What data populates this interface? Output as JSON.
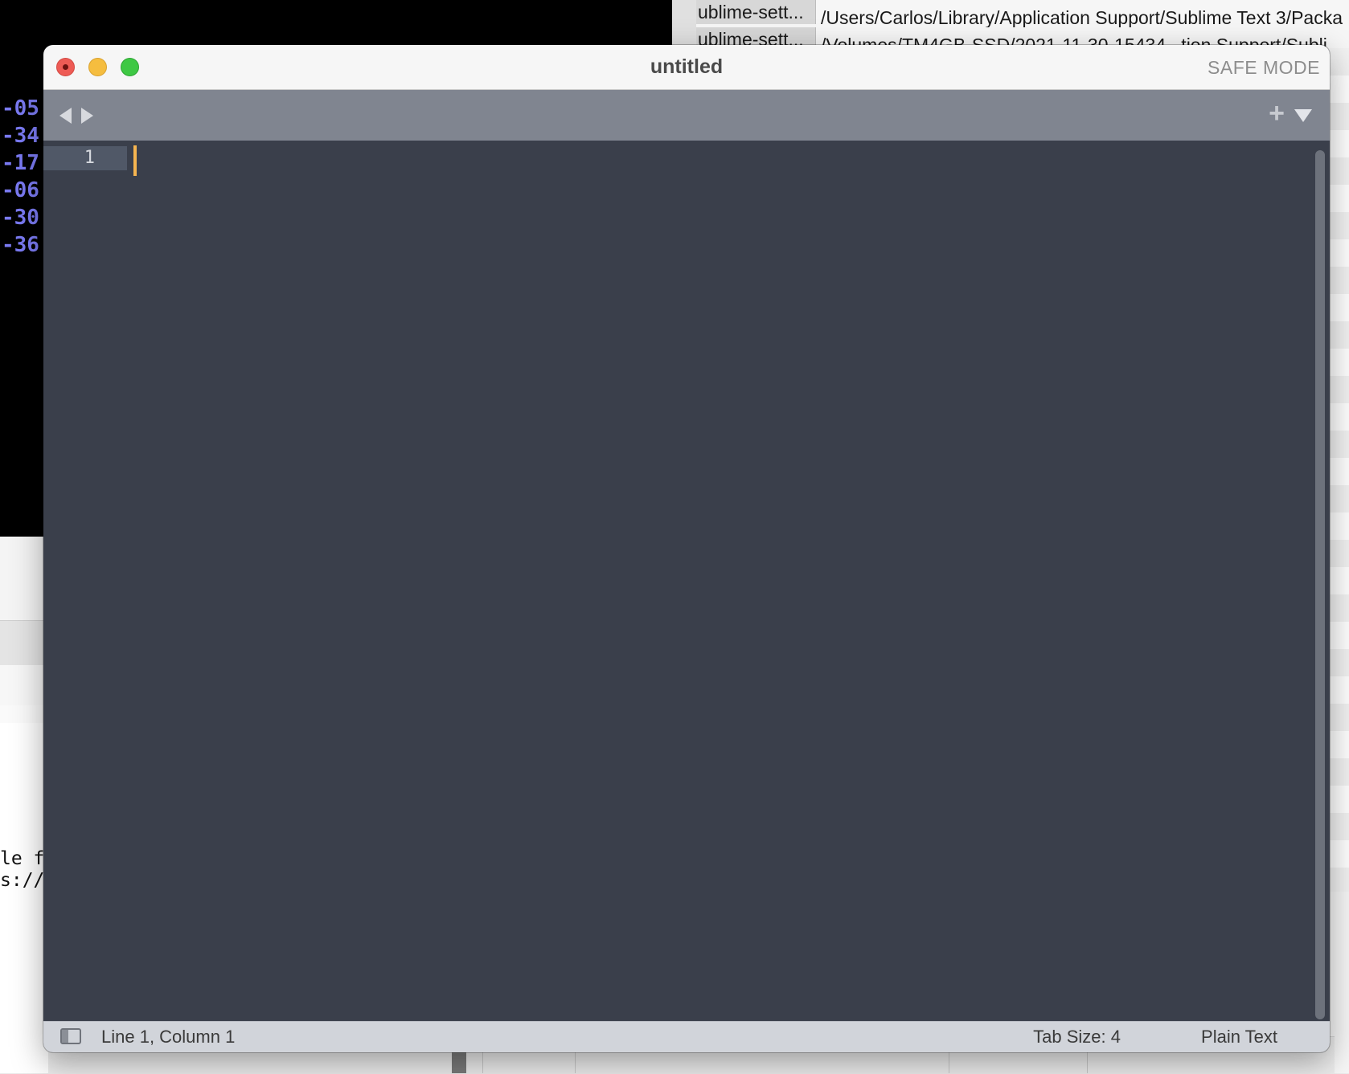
{
  "background": {
    "terminal_lines": [
      "-05",
      "-34",
      "-17",
      "-06",
      "-30",
      "-36"
    ],
    "partial_text_lines": [
      "le f",
      "s://("
    ],
    "finder_rows": [
      {
        "name": "ublime-sett...",
        "path": "/Users/Carlos/Library/Application Support/Sublime Text 3/Packa"
      },
      {
        "name": "ublime-sett...",
        "path": "/Volumes/TM4GB-SSD/2021-11-30-15434...tion Support/Subli"
      }
    ]
  },
  "window": {
    "title": "untitled",
    "mode_badge": "SAFE MODE",
    "traffic_lights": [
      "close",
      "minimize",
      "zoom"
    ],
    "colors": {
      "editor_bg": "#3a3f4b",
      "tabbar_bg": "#808590",
      "caret": "#f6b550",
      "close": "#ee5b55",
      "minimize": "#f5bd3f",
      "zoom": "#3ec844"
    }
  },
  "tabbar": {
    "nav_back_icon": "triangle-left-icon",
    "nav_forward_icon": "triangle-right-icon",
    "new_tab_label": "+",
    "dropdown_icon": "triangle-down-icon"
  },
  "editor": {
    "line_numbers": [
      "1"
    ],
    "content": ""
  },
  "statusbar": {
    "sidebar_icon": "sidebar-toggle-icon",
    "position": "Line 1, Column 1",
    "tab_size": "Tab Size: 4",
    "syntax": "Plain Text"
  }
}
